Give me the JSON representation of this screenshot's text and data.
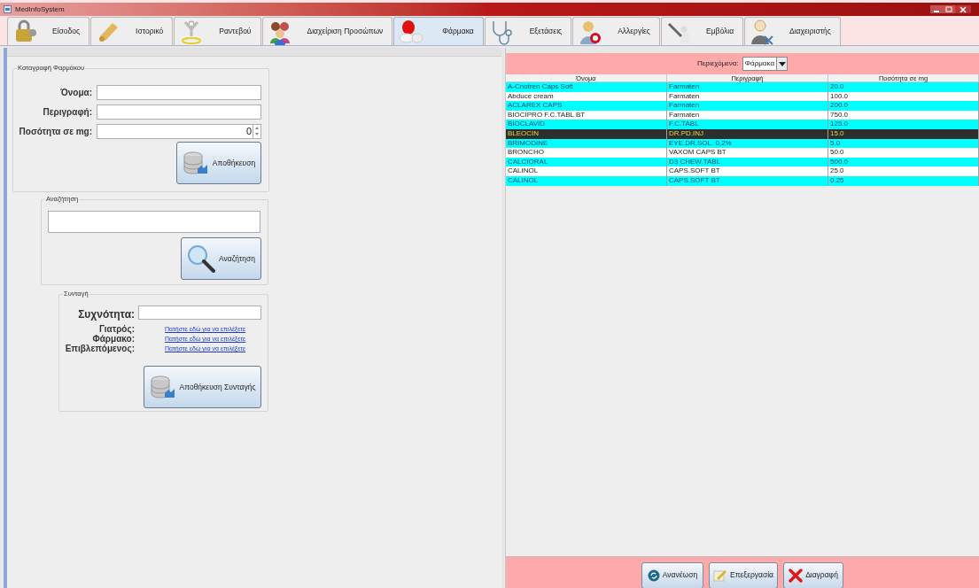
{
  "window": {
    "title": "MedInfoSystem"
  },
  "tabs": [
    {
      "label": "Είσοδος",
      "selected": false
    },
    {
      "label": "Ιστορικό",
      "selected": false
    },
    {
      "label": "Ραντεβού",
      "selected": false
    },
    {
      "label": "Διαχείριση Προσώπων",
      "selected": false
    },
    {
      "label": "Φάρμακα",
      "selected": true
    },
    {
      "label": "Εξετάσεις",
      "selected": false
    },
    {
      "label": "Αλλεργίες",
      "selected": false
    },
    {
      "label": "Εμβόλια",
      "selected": false
    },
    {
      "label": "Διαχειριστής",
      "selected": false
    }
  ],
  "drug_form": {
    "title": "Καταγραφή Φαρμάκου",
    "name_label": "Όνομα:",
    "description_label": "Περιγραφή:",
    "quantity_label": "Ποσότητα σε mg:",
    "quantity_value": "0",
    "save_button": "Αποθήκευση"
  },
  "search": {
    "title": "Αναζήτηση",
    "button": "Αναζήτηση"
  },
  "prescription": {
    "title": "Συνταγή",
    "frequency_label": "Συχνότητα:",
    "pickers": [
      {
        "label": "Γιατρός:",
        "link": "Πατήστε εδώ για να επιλέξετε"
      },
      {
        "label": "Φάρμακο:",
        "link": "Πατήστε εδώ για να επιλέξετε"
      },
      {
        "label": "Επιβλεπόμενος:",
        "link": "Πατήστε εδώ για να επιλέξετε"
      }
    ],
    "save_button": "Αποθήκευση Συνταγής"
  },
  "contents": {
    "label": "Περιεχόμενα:",
    "value": "Φάρμακα"
  },
  "table": {
    "columns": [
      "Όνομα",
      "Περιγραφή",
      "Ποσότητα σε mg"
    ],
    "rows": [
      {
        "cells": [
          "A-Cnotren Caps Soft",
          "Farmaten",
          "20.0"
        ],
        "selected": false
      },
      {
        "cells": [
          "Abduce cream",
          "Farmaten",
          "100.0"
        ],
        "selected": false
      },
      {
        "cells": [
          "ACLAREX CAPS",
          "Farmaten",
          "200.0"
        ],
        "selected": false
      },
      {
        "cells": [
          "BIOCIPRO F.C.TABL BT",
          "Farmaten",
          "750.0"
        ],
        "selected": false
      },
      {
        "cells": [
          "BIOCLAVID",
          "F.C.TABL",
          "125.0"
        ],
        "selected": false
      },
      {
        "cells": [
          "BLEOCIN",
          "DR.PD.INJ",
          "15.0"
        ],
        "selected": true
      },
      {
        "cells": [
          "BRIMODINE",
          "EYE.DR.SOL. 0,2%",
          "5.0"
        ],
        "selected": false
      },
      {
        "cells": [
          "BRONCHO",
          "VAXOM CAPS BT",
          "50.0"
        ],
        "selected": false
      },
      {
        "cells": [
          "CALCIORAL",
          "D3 CHEW.TABL",
          "500.0"
        ],
        "selected": false
      },
      {
        "cells": [
          "CALINOL",
          "CAPS.SOFT BT",
          "25.0"
        ],
        "selected": false
      },
      {
        "cells": [
          "CALINOL",
          "CAPS.SOFT BT",
          "0.25"
        ],
        "selected": false
      }
    ]
  },
  "actions": [
    "Ανανέωση",
    "Επεξεργασία",
    "Διαγραφή"
  ]
}
